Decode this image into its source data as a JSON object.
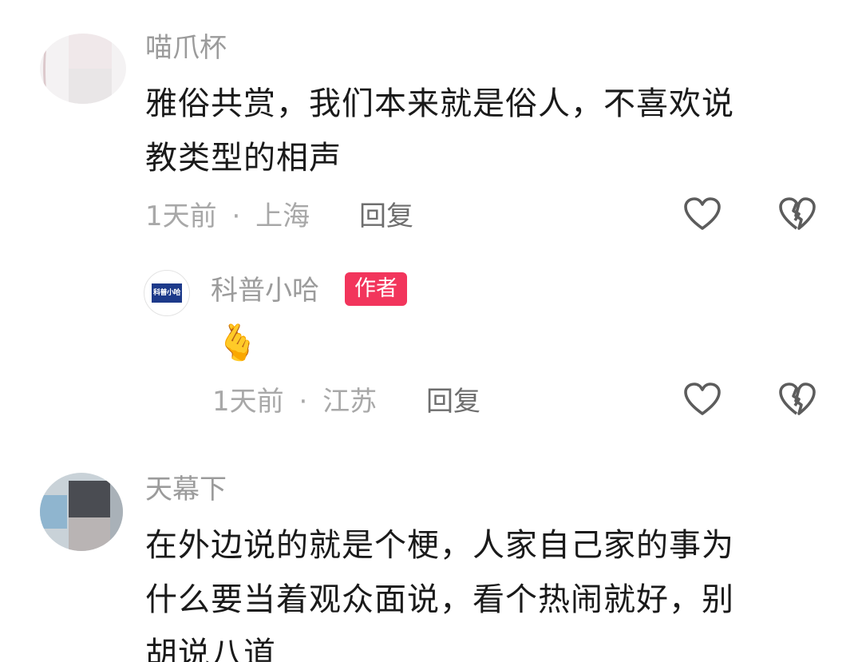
{
  "comments": [
    {
      "username": "喵爪杯",
      "lines": [
        "雅俗共赏，我们本来就是俗人，不喜欢说",
        "教类型的相声"
      ],
      "time": "1天前",
      "separator": "·",
      "location": "上海",
      "reply_label": "回复",
      "reply": {
        "username": "科普小哈",
        "badge": "作者",
        "avatar_text": "科普小哈",
        "emoji": "🫰",
        "time": "1天前",
        "separator": "·",
        "location": "江苏",
        "reply_label": "回复"
      }
    },
    {
      "username": "天幕下",
      "lines": [
        "在外边说的就是个梗，人家自己家的事为",
        "什么要当着观众面说，看个热闹就好，别",
        "胡说八道"
      ]
    }
  ],
  "icons": {
    "like": "heart-outline-icon",
    "dislike": "broken-heart-icon"
  },
  "colors": {
    "badge": "#f2355c",
    "username": "#9b9b9b",
    "text": "#1a1a1a",
    "meta": "#a8a8a8"
  }
}
